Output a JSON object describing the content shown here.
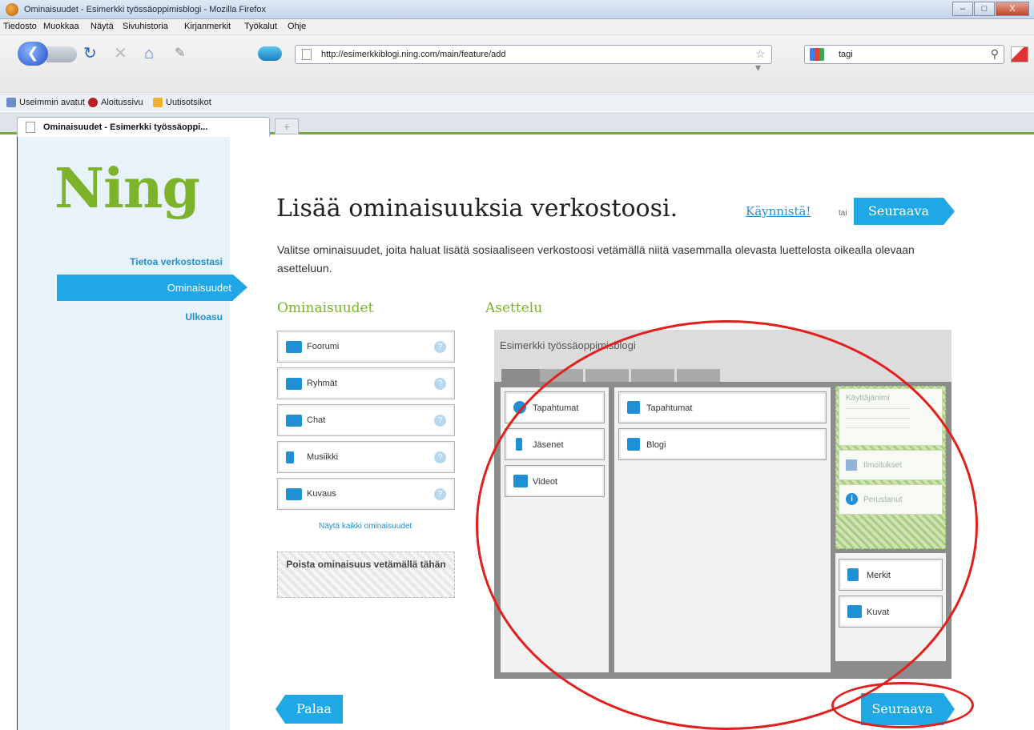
{
  "window": {
    "title": "Ominaisuudet - Esimerkki työssäoppimisblogi - Mozilla Firefox",
    "buttons": [
      "–",
      "□",
      "X"
    ]
  },
  "menu": [
    "Tiedosto",
    "Muokkaa",
    "Näytä",
    "Sivuhistoria",
    "Kirjanmerkit",
    "Työkalut",
    "Ohje"
  ],
  "navbar": {
    "url": "http://esimerkkiblogi.ning.com/main/feature/add",
    "search_value": "tagi"
  },
  "bookmarks": [
    {
      "label": "Useimmin avatut",
      "color": "#6c8fc9"
    },
    {
      "label": "Aloitussivu",
      "color": "#b82025"
    },
    {
      "label": "Uutisotsikot",
      "color": "#f0b032"
    }
  ],
  "tab": {
    "label": "Ominaisuudet - Esimerkki työssäoppi...",
    "new_tab": "+"
  },
  "sidebar": {
    "logo": "Ning",
    "items": [
      "Tietoa verkostostasi",
      "Ominaisuudet",
      "Ulkoasu"
    ]
  },
  "main": {
    "heading": "Lisää ominaisuuksia verkostoosi.",
    "start_link": "Käynnistä!",
    "or_text": "tai",
    "next_label": "Seuraava",
    "intro": "Valitse ominaisuudet, joita haluat lisätä sosiaaliseen verkostoosi vetämällä niitä vasemmalla olevasta luettelosta oikealla olevaan asetteluun.",
    "features_title": "Ominaisuudet",
    "layout_title": "Asettelu",
    "features": [
      "Foorumi",
      "Ryhmät",
      "Chat",
      "Musiikki",
      "Kuvaus"
    ],
    "help_icon": "?",
    "show_all": "Näytä kaikki ominaisuudet",
    "trash_label": "Poista ominaisuus vetämällä tähän",
    "back_label": "Palaa"
  },
  "layout": {
    "network_name": "Esimerkki työssäoppimisblogi",
    "left_column": [
      "Tapahtumat",
      "Jäsenet",
      "Videot"
    ],
    "center_column": [
      "Tapahtumat",
      "Blogi"
    ],
    "right_fixed": [
      "Käyttäjänimi",
      "Ilmoitukset",
      "Perustanut"
    ],
    "right_column": [
      "Merkit",
      "Kuvat"
    ]
  },
  "colors": {
    "accent": "#1fa7e6",
    "logo_green": "#7cb32a",
    "annotation_red": "#e0201c"
  }
}
